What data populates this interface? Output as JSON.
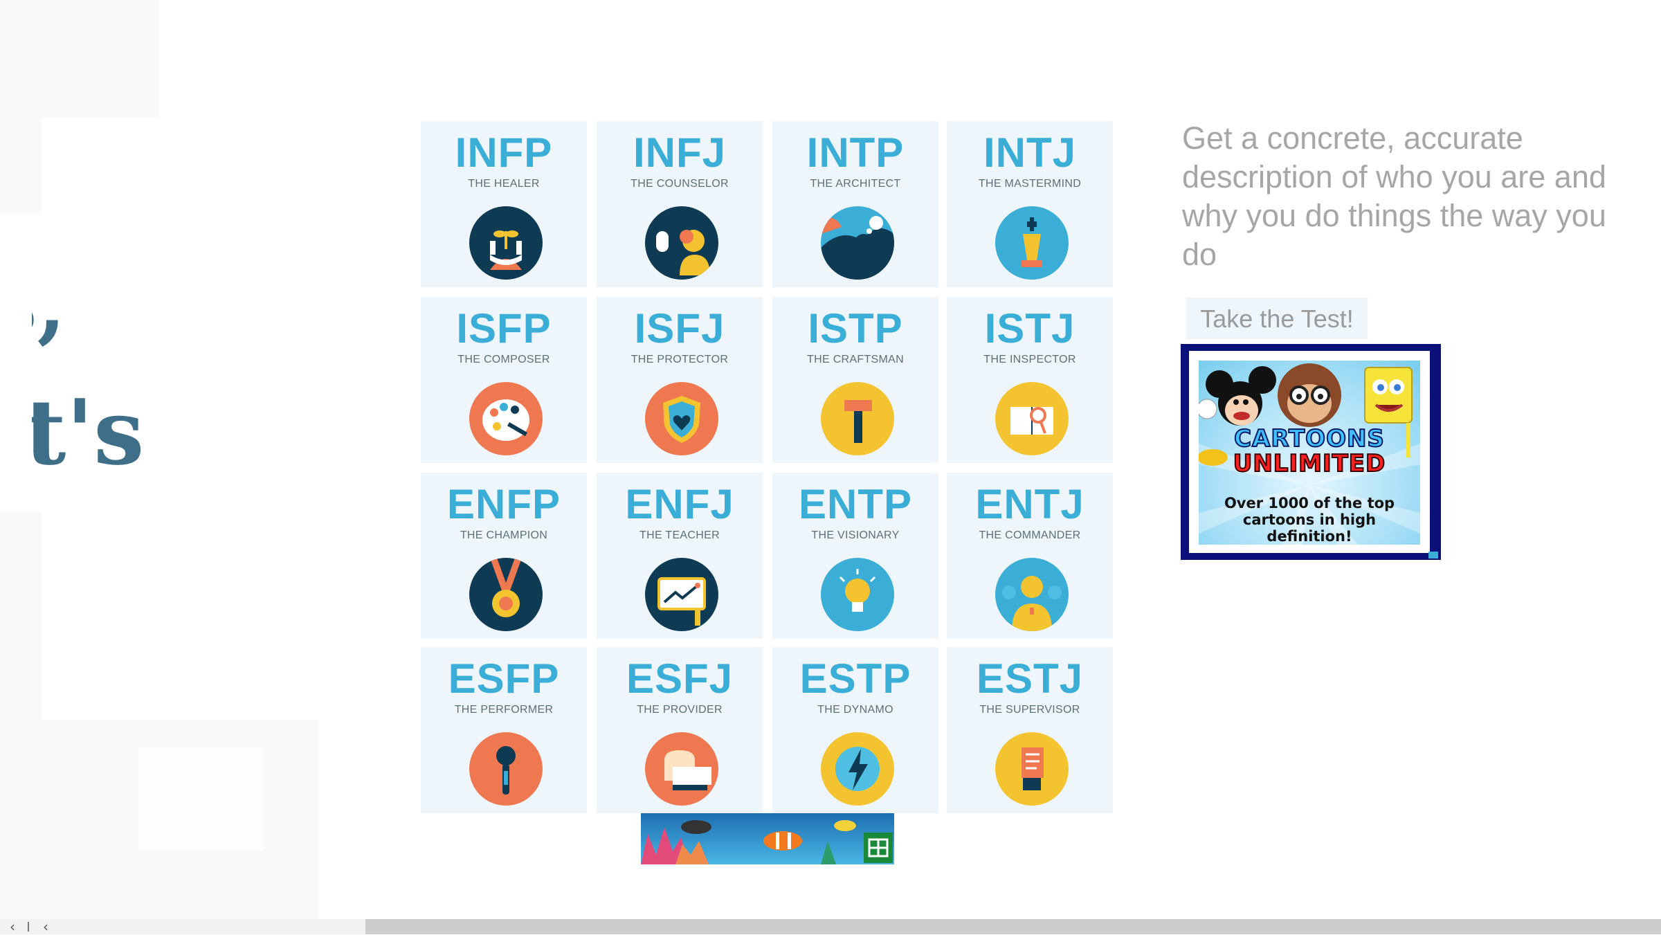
{
  "hero": {
    "line1": "s,",
    "line2": "it's"
  },
  "types": [
    {
      "code": "INFP",
      "name": "THE HEALER",
      "color": "#0f3a54",
      "icon": "hands-plant-icon"
    },
    {
      "code": "INFJ",
      "name": "THE COUNSELOR",
      "color": "#0f3a54",
      "icon": "speaking-person-icon"
    },
    {
      "code": "INTP",
      "name": "THE ARCHITECT",
      "color": "#3aaed6",
      "icon": "thinker-icon"
    },
    {
      "code": "INTJ",
      "name": "THE MASTERMIND",
      "color": "#3aaed6",
      "icon": "chess-king-icon"
    },
    {
      "code": "ISFP",
      "name": "THE COMPOSER",
      "color": "#f07850",
      "icon": "paint-palette-icon"
    },
    {
      "code": "ISFJ",
      "name": "THE PROTECTOR",
      "color": "#f07850",
      "icon": "heart-shield-icon"
    },
    {
      "code": "ISTP",
      "name": "THE CRAFTSMAN",
      "color": "#f4c430",
      "icon": "hammer-icon"
    },
    {
      "code": "ISTJ",
      "name": "THE INSPECTOR",
      "color": "#f4c430",
      "icon": "book-magnifier-icon"
    },
    {
      "code": "ENFP",
      "name": "THE CHAMPION",
      "color": "#0f3a54",
      "icon": "medal-icon"
    },
    {
      "code": "ENFJ",
      "name": "THE TEACHER",
      "color": "#0f3a54",
      "icon": "chart-board-icon"
    },
    {
      "code": "ENTP",
      "name": "THE VISIONARY",
      "color": "#3aaed6",
      "icon": "lightbulb-icon"
    },
    {
      "code": "ENTJ",
      "name": "THE COMMANDER",
      "color": "#3aaed6",
      "icon": "commander-icon"
    },
    {
      "code": "ESFP",
      "name": "THE PERFORMER",
      "color": "#f07850",
      "icon": "microphone-icon"
    },
    {
      "code": "ESFJ",
      "name": "THE PROVIDER",
      "color": "#f07850",
      "icon": "bread-plate-icon"
    },
    {
      "code": "ESTP",
      "name": "THE DYNAMO",
      "color": "#f4c430",
      "icon": "lightning-icon"
    },
    {
      "code": "ESTJ",
      "name": "THE SUPERVISOR",
      "color": "#f4c430",
      "icon": "checklist-icon"
    }
  ],
  "description": "Get a concrete, accurate description of who you are and why you do things the way you do",
  "cta": {
    "label": "Take the Test!"
  },
  "ad": {
    "title_line1": "CARTOONS",
    "title_line2": "UNLIMITED",
    "caption": "Over 1000 of the top cartoons in high definition!"
  },
  "scroll": {
    "left_btn": "‹",
    "back_btn": "‹"
  }
}
